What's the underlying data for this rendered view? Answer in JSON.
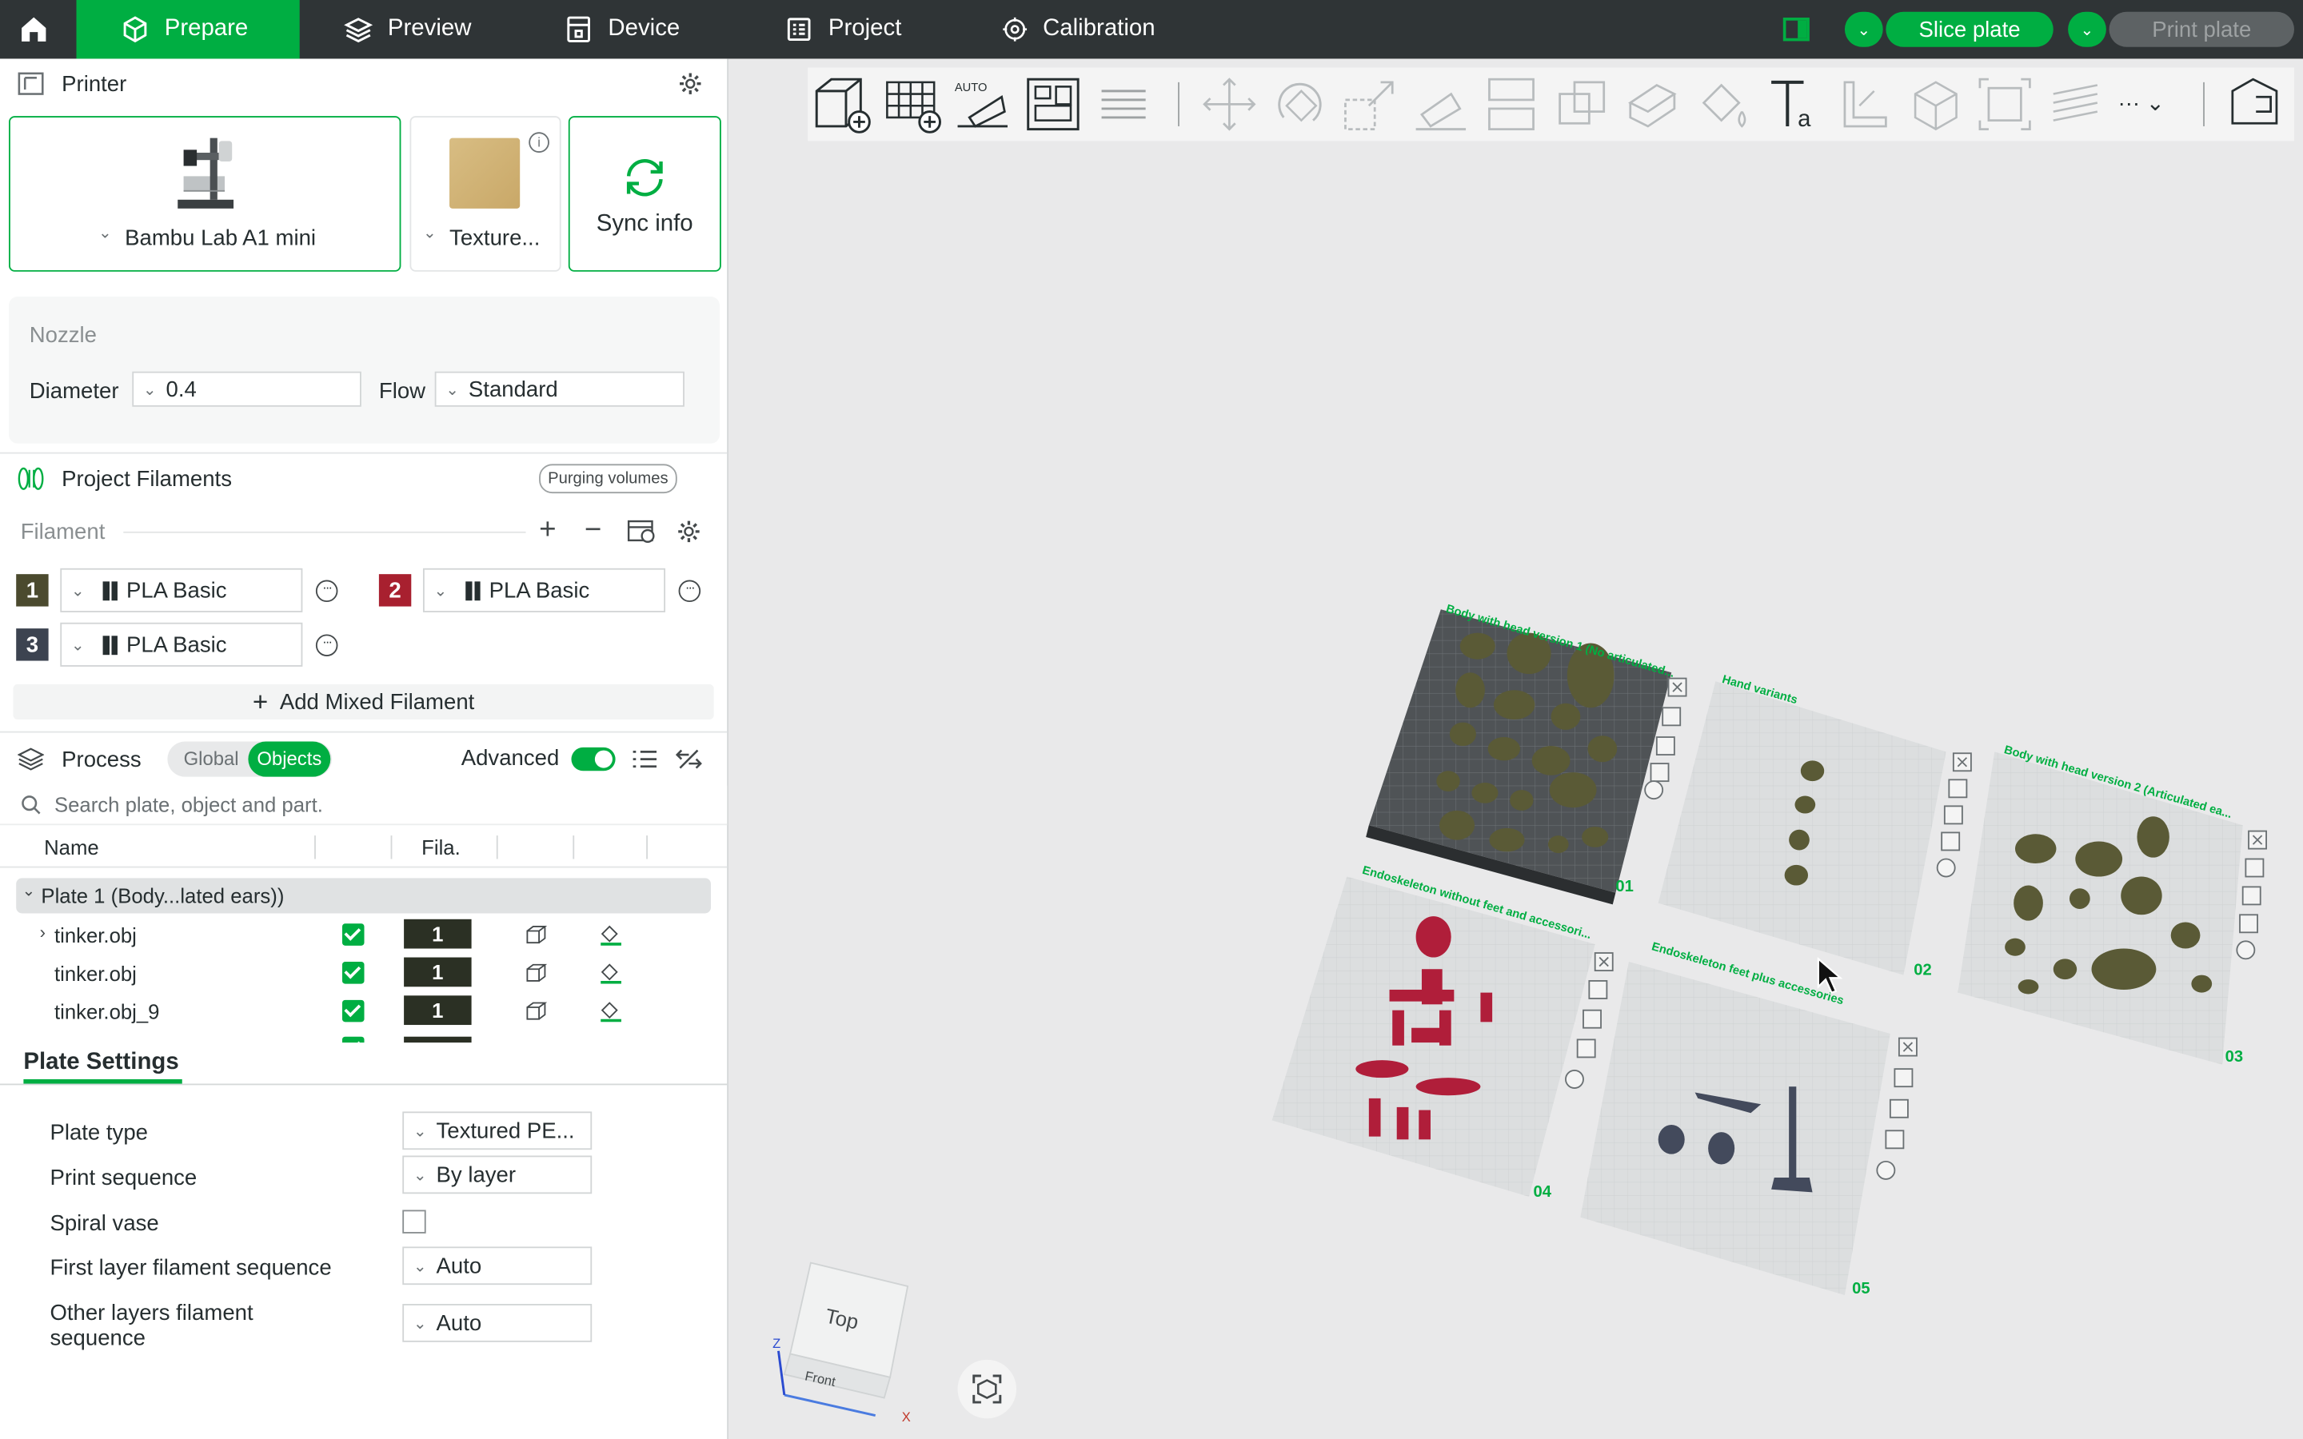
{
  "nav": {
    "tabs": [
      {
        "label": "Prepare",
        "icon": "cube-icon",
        "active": true
      },
      {
        "label": "Preview",
        "icon": "layers-icon",
        "active": false
      },
      {
        "label": "Device",
        "icon": "device-icon",
        "active": false
      },
      {
        "label": "Project",
        "icon": "project-icon",
        "active": false
      },
      {
        "label": "Calibration",
        "icon": "calibration-icon",
        "active": false
      }
    ],
    "slice_label": "Slice plate",
    "print_label": "Print plate",
    "accent": "#00ae42"
  },
  "printer": {
    "title": "Printer",
    "printer_name": "Bambu Lab A1 mini",
    "plate_name": "Texture...",
    "sync_label": "Sync info",
    "nozzle_title": "Nozzle",
    "diameter_label": "Diameter",
    "diameter_value": "0.4",
    "flow_label": "Flow",
    "flow_value": "Standard"
  },
  "filaments": {
    "title": "Project Filaments",
    "purging_label": "Purging volumes",
    "filament_label": "Filament",
    "items": [
      {
        "index": "1",
        "name": "PLA Basic",
        "color": "#4b4a2e"
      },
      {
        "index": "2",
        "name": "PLA Basic",
        "color": "#a8202f"
      },
      {
        "index": "3",
        "name": "PLA Basic",
        "color": "#3c4350"
      }
    ],
    "add_mixed_label": "Add Mixed Filament"
  },
  "process": {
    "title": "Process",
    "global_label": "Global",
    "objects_label": "Objects",
    "advanced_label": "Advanced",
    "advanced_on": true,
    "search_placeholder": "Search plate, object and part.",
    "col_name": "Name",
    "col_fila": "Fila.",
    "plate_row": "Plate 1 (Body...lated ears))",
    "objects": [
      {
        "name": "tinker.obj",
        "fila": "1",
        "expandable": true
      },
      {
        "name": "tinker.obj",
        "fila": "1",
        "expandable": false
      },
      {
        "name": "tinker.obj_9",
        "fila": "1",
        "expandable": false
      }
    ]
  },
  "plate_settings": {
    "title": "Plate Settings",
    "plate_type_label": "Plate type",
    "plate_type_value": "Textured PE...",
    "print_sequence_label": "Print sequence",
    "print_sequence_value": "By layer",
    "spiral_label": "Spiral vase",
    "spiral_checked": false,
    "first_layer_label": "First layer filament sequence",
    "first_layer_value": "Auto",
    "other_layers_label": "Other layers filament sequence",
    "other_layers_value": "Auto"
  },
  "viewport": {
    "plates": [
      {
        "number": "01",
        "label": "Body with head version 1 (No articulated..."
      },
      {
        "number": "02",
        "label": "Hand variants"
      },
      {
        "number": "03",
        "label": "Body with head version 2 (Articulated ea..."
      },
      {
        "number": "04",
        "label": "Endoskeleton without feet and accessori..."
      },
      {
        "number": "05",
        "label": "Endoskeleton feet plus accessories"
      }
    ],
    "cube_top": "Top",
    "cube_front": "Front",
    "axis_x": "X",
    "axis_z": "Z"
  }
}
